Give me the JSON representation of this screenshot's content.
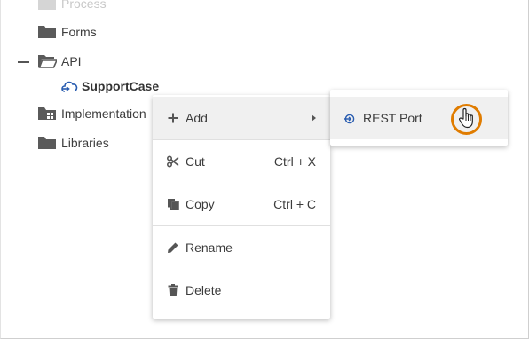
{
  "tree": {
    "items": [
      {
        "label": "Process",
        "icon": "folder-icon",
        "state": "faded"
      },
      {
        "label": "Forms",
        "icon": "folder-icon"
      },
      {
        "label": "API",
        "icon": "folder-open-icon",
        "expanded": true
      },
      {
        "label": "SupportCase",
        "icon": "cloud-api-icon"
      },
      {
        "label": "Implementation",
        "icon": "folder-grid-icon"
      },
      {
        "label": "Libraries",
        "icon": "folder-icon"
      }
    ]
  },
  "context_menu": {
    "items": [
      {
        "label": "Add",
        "icon": "plus-icon",
        "has_submenu": true,
        "active": true
      },
      {
        "label": "Cut",
        "icon": "scissors-icon",
        "shortcut": "Ctrl + X"
      },
      {
        "label": "Copy",
        "icon": "copy-icon",
        "shortcut": "Ctrl + C"
      },
      {
        "label": "Rename",
        "icon": "pencil-icon"
      },
      {
        "label": "Delete",
        "icon": "trash-icon"
      }
    ]
  },
  "submenu": {
    "items": [
      {
        "label": "REST Port",
        "icon": "port-in-icon"
      }
    ]
  },
  "colors": {
    "accent_blue": "#2a5db0",
    "cursor_ring": "#e07c00",
    "folder": "#5a5a5a"
  }
}
